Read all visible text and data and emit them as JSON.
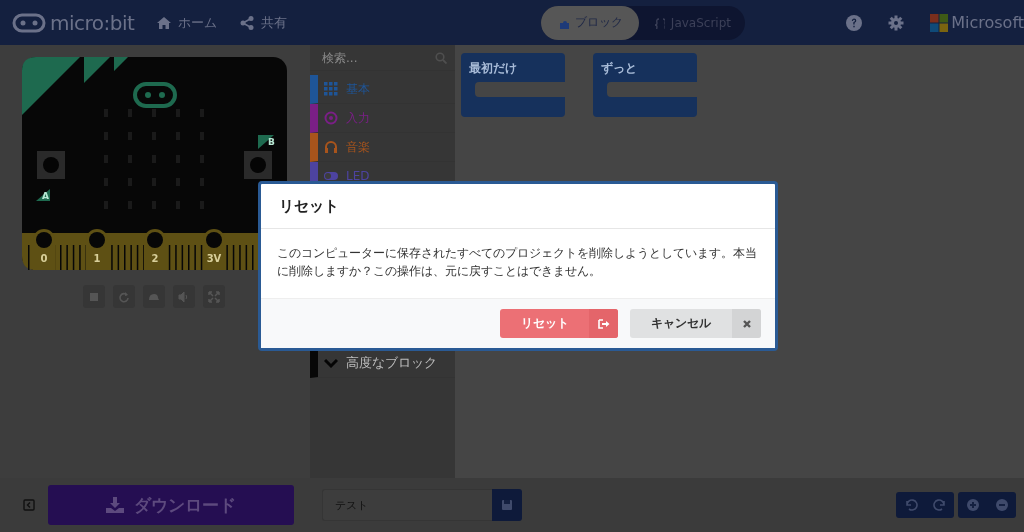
{
  "header": {
    "logo": "micro:bit",
    "nav": [
      {
        "label": "ホーム"
      },
      {
        "label": "共有"
      }
    ],
    "tabs": [
      {
        "label": "ブロック",
        "selected": true
      },
      {
        "label": "JavaScript",
        "selected": false
      }
    ],
    "brand": "Microsoft"
  },
  "simulator": {
    "pins": [
      "0",
      "1",
      "2",
      "3V"
    ],
    "buttons": [
      "A",
      "B"
    ]
  },
  "toolbox": {
    "search": {
      "placeholder": "検索..."
    },
    "categories": [
      {
        "label": "基本",
        "color": "#1e5598"
      },
      {
        "label": "入力",
        "color": "#7a1f86"
      },
      {
        "label": "音楽",
        "color": "#a8541c"
      },
      {
        "label": "LED",
        "color": "#4d43a0"
      }
    ],
    "advanced": "高度なブロック"
  },
  "workspace": {
    "blocks": [
      {
        "label": "最初だけ"
      },
      {
        "label": "ずっと"
      }
    ]
  },
  "modal": {
    "title": "リセット",
    "message": "このコンピューターに保存されたすべてのプロジェクトを削除しようとしています。本当に削除しますか？この操作は、元に戻すことはできません。",
    "buttons": [
      {
        "label": "リセット",
        "kind": "danger"
      },
      {
        "label": "キャンセル",
        "kind": "cancel"
      }
    ]
  },
  "footer": {
    "download": "ダウンロード",
    "project_name": "テスト"
  }
}
